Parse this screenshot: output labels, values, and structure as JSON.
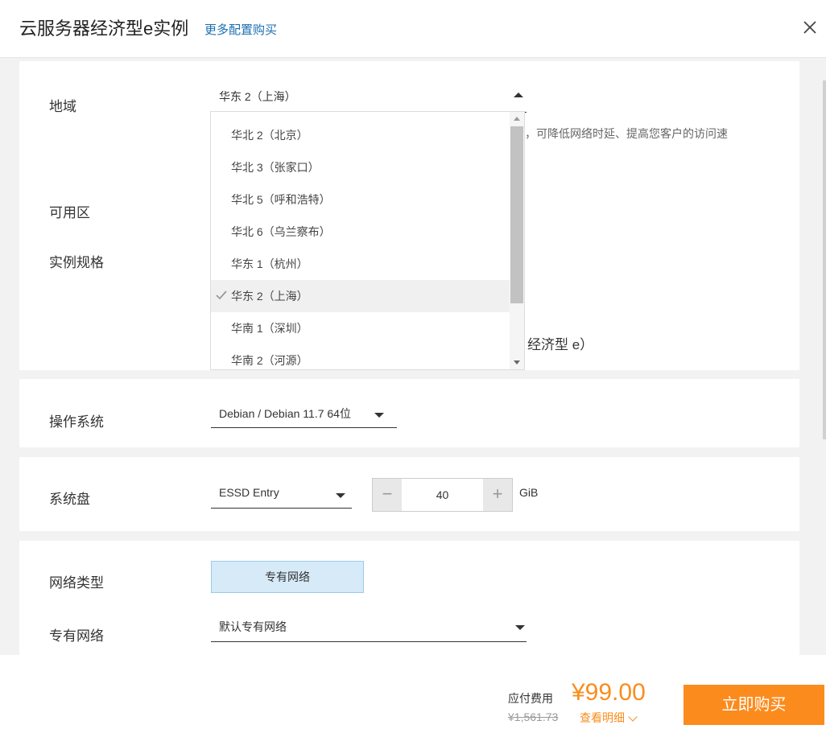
{
  "header": {
    "title": "云服务器经济型e实例",
    "more_link": "更多配置购买"
  },
  "region": {
    "label": "地域",
    "selected": "华东 2（上海）",
    "hint": "，可降低网络时延、提高您客户的访问速",
    "options": [
      "华北 2（北京）",
      "华北 3（张家口）",
      "华北 5（呼和浩特）",
      "华北 6（乌兰察布）",
      "华东 1（杭州）",
      "华东 2（上海）",
      "华南 1（深圳）",
      "华南 2（河源）"
    ],
    "selected_index": 5
  },
  "zone": {
    "label": "可用区"
  },
  "spec": {
    "label": "实例规格",
    "partial_value": "经济型 e）"
  },
  "os": {
    "label": "操作系统",
    "value": "Debian / Debian 11.7 64位"
  },
  "disk": {
    "label": "系统盘",
    "type": "ESSD Entry",
    "size": "40",
    "unit": "GiB",
    "minus": "−",
    "plus": "+"
  },
  "network": {
    "type_label": "网络类型",
    "type_value": "专有网络",
    "vpc_label": "专有网络",
    "vpc_value": "默认专有网络"
  },
  "footer": {
    "fee_label": "应付费用",
    "original_price": "¥1,561.73",
    "price": "¥99.00",
    "detail_link": "查看明细",
    "buy_button": "立即购买"
  },
  "colors": {
    "accent": "#fc8b1d",
    "price": "#f98d1c",
    "link": "#1a6fb0",
    "option_selected_bg": "#d6eaf8"
  }
}
